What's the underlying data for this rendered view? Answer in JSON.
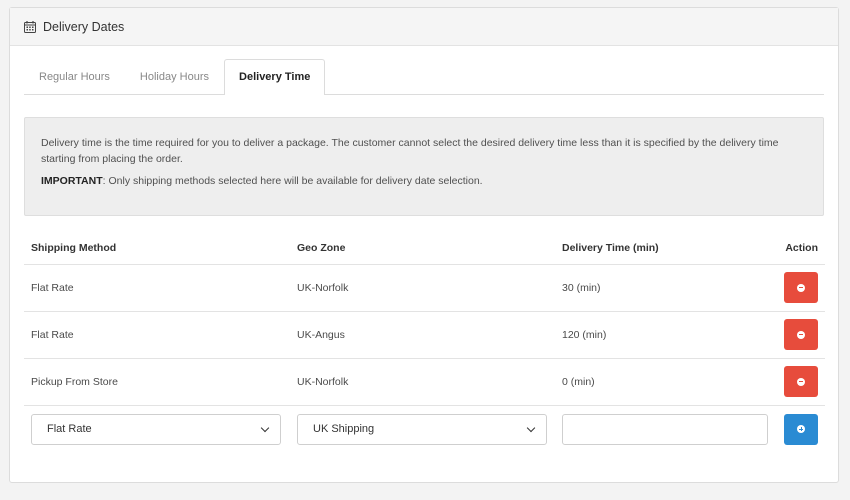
{
  "panel": {
    "title": "Delivery Dates",
    "icon": "calendar-icon"
  },
  "tabs": [
    {
      "label": "Regular Hours",
      "active": false
    },
    {
      "label": "Holiday Hours",
      "active": false
    },
    {
      "label": "Delivery Time",
      "active": true
    }
  ],
  "info": {
    "description": "Delivery time is the time required for you to deliver a package. The customer cannot select the desired delivery time less than it is specified by the delivery time starting from placing the order.",
    "important_label": "IMPORTANT",
    "important_text": ": Only shipping methods selected here will be available for delivery date selection."
  },
  "table": {
    "headers": [
      "Shipping Method",
      "Geo Zone",
      "Delivery Time (min)",
      "Action"
    ],
    "rows": [
      {
        "method": "Flat Rate",
        "zone": "UK-Norfolk",
        "time": "30 (min)"
      },
      {
        "method": "Flat Rate",
        "zone": "UK-Angus",
        "time": "120 (min)"
      },
      {
        "method": "Pickup From Store",
        "zone": "UK-Norfolk",
        "time": "0 (min)"
      }
    ]
  },
  "add_row": {
    "method_selected": "Flat Rate",
    "zone_selected": "UK Shipping",
    "time_value": "",
    "time_placeholder": ""
  },
  "colors": {
    "danger": "#e74c3c",
    "primary": "#2a8bd3"
  }
}
